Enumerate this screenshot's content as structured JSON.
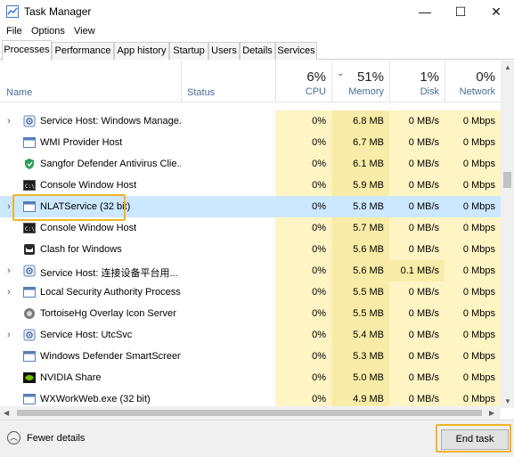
{
  "window": {
    "title": "Task Manager",
    "minimize_glyph": "—",
    "maximize_glyph": "☐",
    "close_glyph": "✕"
  },
  "menu": [
    "File",
    "Options",
    "View"
  ],
  "tabs": [
    "Processes",
    "Performance",
    "App history",
    "Startup",
    "Users",
    "Details",
    "Services"
  ],
  "active_tab": "Processes",
  "columns": {
    "name": "Name",
    "status": "Status",
    "cpu": {
      "pct": "6%",
      "label": "CPU"
    },
    "memory": {
      "pct": "51%",
      "label": "Memory"
    },
    "disk": {
      "pct": "1%",
      "label": "Disk"
    },
    "network": {
      "pct": "0%",
      "label": "Network"
    }
  },
  "rows": [
    {
      "expand": true,
      "icon": "gear-icon",
      "name": "Service Host: Windows Manage...",
      "cpu": "0%",
      "mem": "6.8 MB",
      "disk": "0 MB/s",
      "net": "0 Mbps"
    },
    {
      "expand": false,
      "icon": "window-icon",
      "name": "WMI Provider Host",
      "cpu": "0%",
      "mem": "6.7 MB",
      "disk": "0 MB/s",
      "net": "0 Mbps"
    },
    {
      "expand": false,
      "icon": "shield-icon",
      "name": "Sangfor Defender Antivirus Clie...",
      "cpu": "0%",
      "mem": "6.1 MB",
      "disk": "0 MB/s",
      "net": "0 Mbps"
    },
    {
      "expand": false,
      "icon": "console-icon",
      "name": "Console Window Host",
      "cpu": "0%",
      "mem": "5.9 MB",
      "disk": "0 MB/s",
      "net": "0 Mbps"
    },
    {
      "expand": true,
      "icon": "window-icon",
      "name": "NLATService (32 bit)",
      "cpu": "0%",
      "mem": "5.8 MB",
      "disk": "0 MB/s",
      "net": "0 Mbps",
      "selected": true
    },
    {
      "expand": false,
      "icon": "console-icon",
      "name": "Console Window Host",
      "cpu": "0%",
      "mem": "5.7 MB",
      "disk": "0 MB/s",
      "net": "0 Mbps"
    },
    {
      "expand": false,
      "icon": "cat-icon",
      "name": "Clash for Windows",
      "cpu": "0%",
      "mem": "5.6 MB",
      "disk": "0 MB/s",
      "net": "0 Mbps"
    },
    {
      "expand": true,
      "icon": "gear-icon",
      "name": "Service Host: 连接设备平台用...",
      "cpu": "0%",
      "mem": "5.6 MB",
      "disk": "0.1 MB/s",
      "net": "0 Mbps",
      "disk_highlight": true
    },
    {
      "expand": true,
      "icon": "window-icon",
      "name": "Local Security Authority Process...",
      "cpu": "0%",
      "mem": "5.5 MB",
      "disk": "0 MB/s",
      "net": "0 Mbps"
    },
    {
      "expand": false,
      "icon": "tortoise-icon",
      "name": "TortoiseHg Overlay Icon Server",
      "cpu": "0%",
      "mem": "5.5 MB",
      "disk": "0 MB/s",
      "net": "0 Mbps"
    },
    {
      "expand": true,
      "icon": "gear-icon",
      "name": "Service Host: UtcSvc",
      "cpu": "0%",
      "mem": "5.4 MB",
      "disk": "0 MB/s",
      "net": "0 Mbps"
    },
    {
      "expand": false,
      "icon": "window-icon",
      "name": "Windows Defender SmartScreen",
      "cpu": "0%",
      "mem": "5.3 MB",
      "disk": "0 MB/s",
      "net": "0 Mbps"
    },
    {
      "expand": false,
      "icon": "nvidia-icon",
      "name": "NVIDIA Share",
      "cpu": "0%",
      "mem": "5.0 MB",
      "disk": "0 MB/s",
      "net": "0 Mbps"
    },
    {
      "expand": false,
      "icon": "window-icon",
      "name": "WXWorkWeb.exe (32 bit)",
      "cpu": "0%",
      "mem": "4.9 MB",
      "disk": "0 MB/s",
      "net": "0 Mbps"
    }
  ],
  "footer": {
    "fewer_details": "Fewer details",
    "end_task": "End task"
  },
  "colors": {
    "selected_row": "#cce8ff",
    "heat_light": "#fff4c4",
    "heat_medium": "#f9eca8",
    "highlight_outline": "#f0b429"
  }
}
